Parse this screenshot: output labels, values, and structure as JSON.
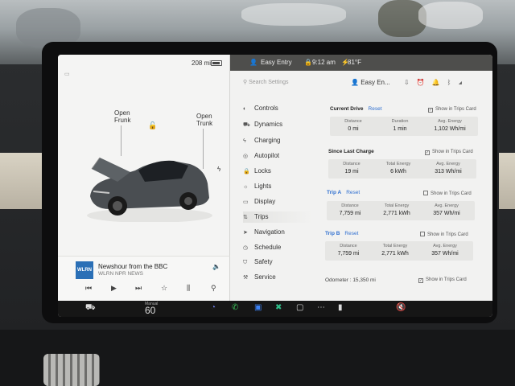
{
  "status": {
    "range": "208 mi",
    "profile": "Easy Entry",
    "time": "9:12 am",
    "temperature": "81°F"
  },
  "car": {
    "frunk_label": "Open\nFrunk",
    "trunk_label": "Open\nTrunk"
  },
  "media": {
    "logo": "WLRN",
    "title": "Newshour from the BBC",
    "station": "WLRN NPR NEWS"
  },
  "settings": {
    "search_placeholder": "Search Settings",
    "profile_name": "Easy En...",
    "menu": [
      {
        "label": "Controls",
        "icon": "toggle-icon"
      },
      {
        "label": "Dynamics",
        "icon": "car-icon"
      },
      {
        "label": "Charging",
        "icon": "bolt-icon"
      },
      {
        "label": "Autopilot",
        "icon": "steering-icon"
      },
      {
        "label": "Locks",
        "icon": "lock-icon"
      },
      {
        "label": "Lights",
        "icon": "bulb-icon"
      },
      {
        "label": "Display",
        "icon": "display-icon"
      },
      {
        "label": "Trips",
        "icon": "trips-icon"
      },
      {
        "label": "Navigation",
        "icon": "arrow-icon"
      },
      {
        "label": "Schedule",
        "icon": "clock-icon"
      },
      {
        "label": "Safety",
        "icon": "shield-icon"
      },
      {
        "label": "Service",
        "icon": "wrench-icon"
      }
    ]
  },
  "trips": {
    "current": {
      "title": "Current Drive",
      "reset": "Reset",
      "show_label": "Show in Trips Card",
      "headers": [
        "Distance",
        "Duration",
        "Avg. Energy"
      ],
      "values": [
        "0 mi",
        "1 min",
        "1,102 Wh/mi"
      ]
    },
    "since_charge": {
      "title": "Since Last Charge",
      "show_label": "Show in Trips Card",
      "headers": [
        "Distance",
        "Total Energy",
        "Avg. Energy"
      ],
      "values": [
        "19 mi",
        "6 kWh",
        "313 Wh/mi"
      ]
    },
    "trip_a": {
      "title": "Trip A",
      "reset": "Reset",
      "show_label": "Show in Trips Card",
      "headers": [
        "Distance",
        "Total Energy",
        "Avg. Energy"
      ],
      "values": [
        "7,759 mi",
        "2,771 kWh",
        "357 Wh/mi"
      ]
    },
    "trip_b": {
      "title": "Trip B",
      "reset": "Reset",
      "show_label": "Show in Trips Card",
      "headers": [
        "Distance",
        "Total Energy",
        "Avg. Energy"
      ],
      "values": [
        "7,759 mi",
        "2,771 kWh",
        "357 Wh/mi"
      ]
    },
    "odometer": "Odometer : 15,350 mi",
    "odometer_show_label": "Show in Trips Card"
  },
  "taskbar": {
    "climate_mode": "Manual",
    "temp": "60"
  }
}
